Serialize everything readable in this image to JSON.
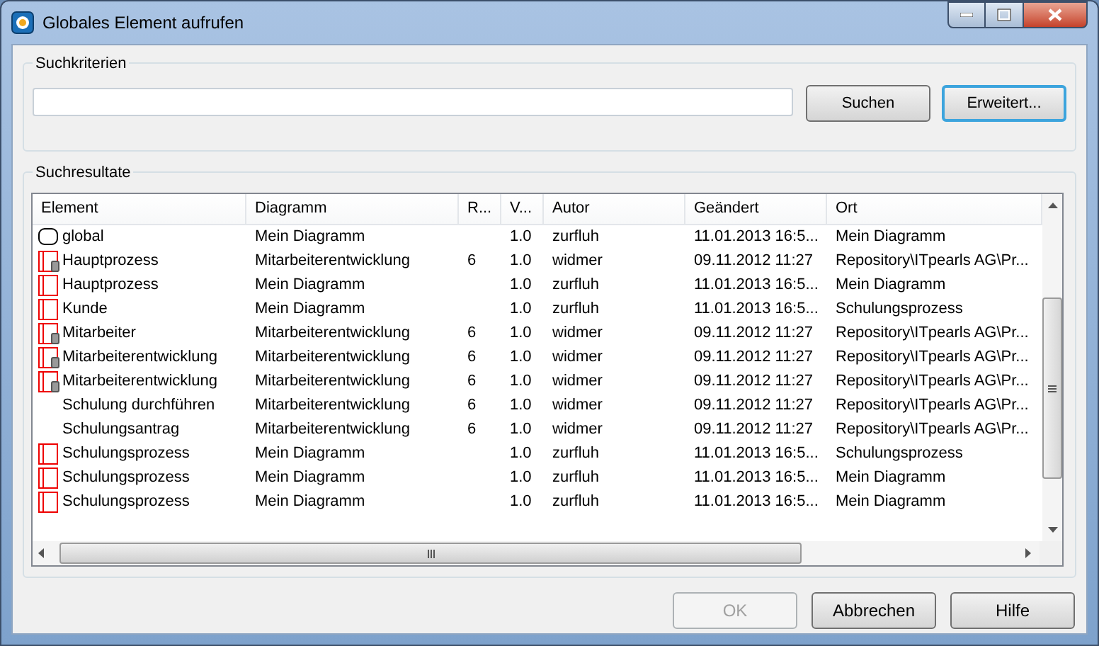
{
  "window": {
    "title": "Globales Element aufrufen"
  },
  "search": {
    "legend": "Suchkriterien",
    "buttons": [
      {
        "label": "Suchen",
        "focused": false
      },
      {
        "label": "Erweitert...",
        "focused": true
      }
    ]
  },
  "results": {
    "legend": "Suchresultate",
    "columns": [
      "Element",
      "Diagramm",
      "R...",
      "V...",
      "Autor",
      "Geändert",
      "Ort"
    ],
    "rows": [
      {
        "kind": "event",
        "cells": [
          "global",
          "Mein Diagramm",
          "",
          "1.0",
          "zurfluh",
          "11.01.2013 16:5...",
          "Mein Diagramm"
        ]
      },
      {
        "kind": "process-ref",
        "cells": [
          "Hauptprozess",
          "Mitarbeiterentwicklung",
          "6",
          "1.0",
          "widmer",
          "09.11.2012 11:27",
          "Repository\\ITpearls AG\\Pr..."
        ]
      },
      {
        "kind": "process",
        "cells": [
          "Hauptprozess",
          "Mein Diagramm",
          "",
          "1.0",
          "zurfluh",
          "11.01.2013 16:5...",
          "Mein Diagramm"
        ]
      },
      {
        "kind": "process",
        "cells": [
          "Kunde",
          "Mein Diagramm",
          "",
          "1.0",
          "zurfluh",
          "11.01.2013 16:5...",
          "Schulungsprozess"
        ]
      },
      {
        "kind": "process-ref",
        "cells": [
          "Mitarbeiter",
          "Mitarbeiterentwicklung",
          "6",
          "1.0",
          "widmer",
          "09.11.2012 11:27",
          "Repository\\ITpearls AG\\Pr..."
        ]
      },
      {
        "kind": "process-ref",
        "cells": [
          "Mitarbeiterentwicklung",
          "Mitarbeiterentwicklung",
          "6",
          "1.0",
          "widmer",
          "09.11.2012 11:27",
          "Repository\\ITpearls AG\\Pr..."
        ]
      },
      {
        "kind": "process-ref",
        "cells": [
          "Mitarbeiterentwicklung",
          "Mitarbeiterentwicklung",
          "6",
          "1.0",
          "widmer",
          "09.11.2012 11:27",
          "Repository\\ITpearls AG\\Pr..."
        ]
      },
      {
        "kind": "none",
        "cells": [
          "Schulung durchführen",
          "Mitarbeiterentwicklung",
          "6",
          "1.0",
          "widmer",
          "09.11.2012 11:27",
          "Repository\\ITpearls AG\\Pr..."
        ]
      },
      {
        "kind": "none",
        "cells": [
          "Schulungsantrag",
          "Mitarbeiterentwicklung",
          "6",
          "1.0",
          "widmer",
          "09.11.2012 11:27",
          "Repository\\ITpearls AG\\Pr..."
        ]
      },
      {
        "kind": "process",
        "cells": [
          "Schulungsprozess",
          "Mein Diagramm",
          "",
          "1.0",
          "zurfluh",
          "11.01.2013 16:5...",
          "Schulungsprozess"
        ]
      },
      {
        "kind": "process",
        "cells": [
          "Schulungsprozess",
          "Mein Diagramm",
          "",
          "1.0",
          "zurfluh",
          "11.01.2013 16:5...",
          "Mein Diagramm"
        ]
      },
      {
        "kind": "process",
        "cells": [
          "Schulungsprozess",
          "Mein Diagramm",
          "",
          "1.0",
          "zurfluh",
          "11.01.2013 16:5...",
          "Mein Diagramm"
        ]
      }
    ]
  },
  "buttons": [
    {
      "label": "OK",
      "disabled": true
    },
    {
      "label": "Abbrechen",
      "disabled": false
    },
    {
      "label": "Hilfe",
      "disabled": false
    }
  ]
}
